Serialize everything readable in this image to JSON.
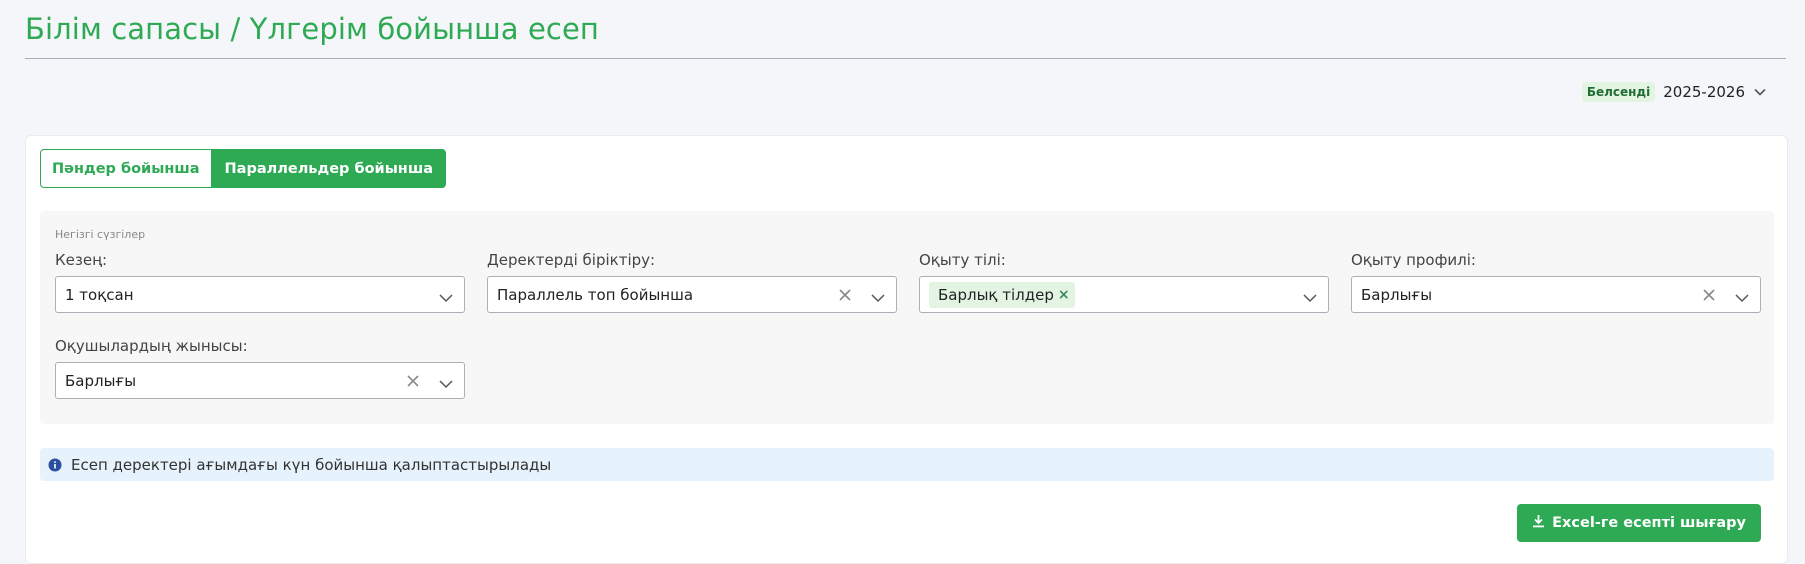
{
  "header": {
    "title": "Білім сапасы / Үлгерім бойынша есеп"
  },
  "year_selector": {
    "status_badge": "Белсенді",
    "year": "2025-2026",
    "icon": "chevron-down-icon"
  },
  "tabs": [
    {
      "label": "Пәндер бойынша",
      "active": false
    },
    {
      "label": "Параллельдер бойынша",
      "active": true
    }
  ],
  "filters": {
    "heading": "Негізгі сүзгілер",
    "period": {
      "label": "Кезең:",
      "value": "1 тоқсан"
    },
    "grouping": {
      "label": "Деректерді біріктіру:",
      "value": "Параллель топ бойынша"
    },
    "language": {
      "label": "Оқыту тілі:",
      "tag": "Барлық тілдер",
      "tag_remove": "×"
    },
    "profile": {
      "label": "Оқыту профилі:",
      "value": "Барлығы"
    },
    "gender": {
      "label": "Оқушылардың жынысы:",
      "value": "Барлығы"
    }
  },
  "info": {
    "text": "Есеп деректері ағымдағы күн бойынша қалыптастырылады",
    "icon": "info-icon"
  },
  "export_button": {
    "label": "Excel-ге есепті шығару",
    "icon": "download-icon"
  },
  "colors": {
    "accent": "#2eaa54",
    "badge_bg": "#e3f4e3",
    "info_bg": "#e6f3fc",
    "info_icon": "#2a4fa0"
  }
}
